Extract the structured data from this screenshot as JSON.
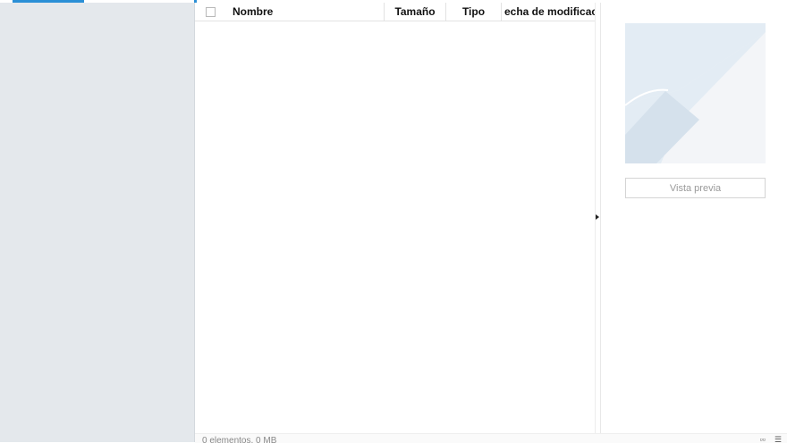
{
  "file_list": {
    "columns": {
      "name": "Nombre",
      "size": "Tamaño",
      "type": "Tipo",
      "modified": "echa de modificación"
    },
    "rows": []
  },
  "preview": {
    "button_label": "Vista previa"
  },
  "status_bar": {
    "summary": "0 elementos, 0 MB"
  },
  "colors": {
    "accent": "#2a8fd6",
    "sidebar_bg": "#e4e8ec",
    "placeholder_light": "#f3f5f8",
    "placeholder_mid": "#e3ecf4",
    "placeholder_dark": "#d5e1ec"
  },
  "icons": {
    "splitter": "caret-right-icon",
    "preview_placeholder": "image-placeholder-icon",
    "view_grid": "grid-view-icon",
    "view_list": "list-view-icon"
  }
}
